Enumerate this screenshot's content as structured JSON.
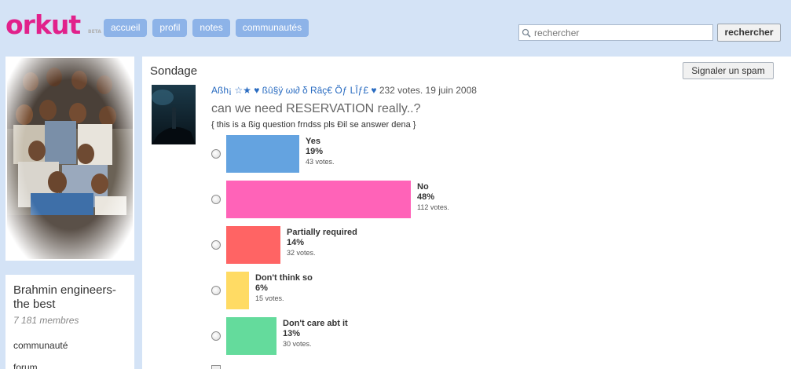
{
  "header": {
    "logo": "orkut",
    "logo_badge": "BETA",
    "nav": [
      "accueil",
      "profil",
      "notes",
      "communautés"
    ],
    "search_placeholder": "rechercher",
    "search_button": "rechercher"
  },
  "community": {
    "name": "Brahmin engineers-the best",
    "members": "7 181 membres",
    "links": [
      "communauté",
      "forum"
    ]
  },
  "poll": {
    "section_title": "Sondage",
    "spam_button": "Signaler un spam",
    "author": "Aßh¡ ☆★ ♥ ßû§ÿ ωι∂ δ Râç€ Õƒ LÎƒ£ ♥",
    "meta": "232 votes. 19 juin 2008",
    "question": "can we need RESERVATION really..?",
    "description": "{ this is a ßig question frndss pls Ðil se answer dena }",
    "options": [
      {
        "label": "Yes",
        "percent": "19%",
        "votes": "43 votes.",
        "share": 0.19,
        "color": "#64a3e0"
      },
      {
        "label": "No",
        "percent": "48%",
        "votes": "112 votes.",
        "share": 0.48,
        "color": "#ff63b8"
      },
      {
        "label": "Partially required",
        "percent": "14%",
        "votes": "32 votes.",
        "share": 0.14,
        "color": "#ff6464"
      },
      {
        "label": "Don't think so",
        "percent": "6%",
        "votes": "15 votes.",
        "share": 0.06,
        "color": "#ffdb64"
      },
      {
        "label": "Don't care abt it",
        "percent": "13%",
        "votes": "30 votes.",
        "share": 0.13,
        "color": "#64db9c"
      }
    ]
  }
}
